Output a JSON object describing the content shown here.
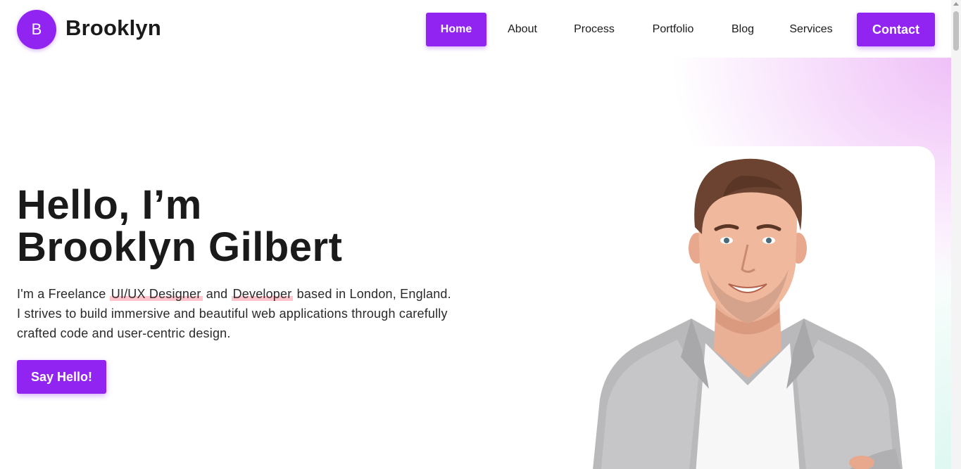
{
  "brand": {
    "initial": "B",
    "name": "Brooklyn"
  },
  "nav": {
    "items": [
      "Home",
      "About",
      "Process",
      "Portfolio",
      "Blog",
      "Services"
    ],
    "active": "Home",
    "contact_label": "Contact"
  },
  "hero": {
    "title_line1": "Hello, I’m",
    "title_line2": "Brooklyn Gilbert",
    "desc_part1": "I'm a Freelance ",
    "highlight1": "UI/UX Designer",
    "desc_part2": " and ",
    "highlight2": "Developer",
    "desc_part3": " based in London, England. I strives to build immersive and beautiful web applications through carefully crafted code and user-centric design.",
    "cta_label": "Say Hello!"
  },
  "colors": {
    "accent": "#9224f2",
    "highlight": "#ffc3cc",
    "gradient_pink": "#f3cdfa",
    "gradient_mint": "#ccf3e9"
  }
}
